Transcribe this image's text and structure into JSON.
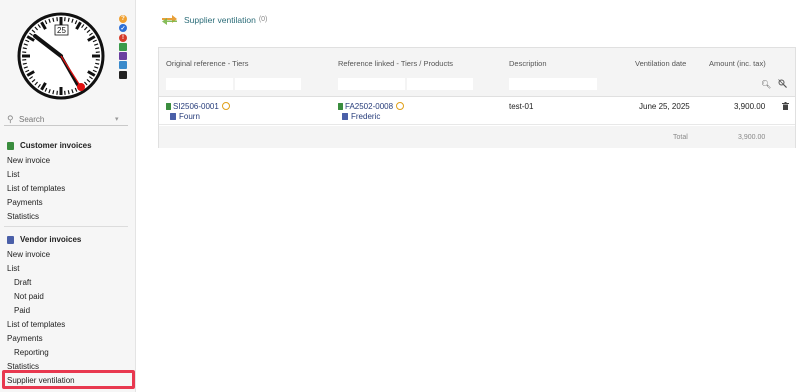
{
  "clock": {
    "digit": "25"
  },
  "search": {
    "placeholder": "Search"
  },
  "menu": {
    "customer_heading": "Customer invoices",
    "customer_items": [
      "New invoice",
      "List",
      "List of templates",
      "Payments",
      "Statistics"
    ],
    "vendor_heading": "Vendor invoices",
    "vendor_items": {
      "new_invoice": "New invoice",
      "list": "List",
      "draft": "Draft",
      "not_paid": "Not paid",
      "paid": "Paid",
      "list_templates": "List of templates",
      "payments": "Payments",
      "reporting": "Reporting",
      "statistics": "Statistics",
      "supplier_ventilation": "Supplier ventilation"
    }
  },
  "page": {
    "title": "Supplier ventilation",
    "count": "(0)"
  },
  "table": {
    "headers": {
      "original_ref": "Original reference - Tiers",
      "reference_linked": "Reference linked - Tiers / Products",
      "description": "Description",
      "ventilation_date": "Ventilation date",
      "amount": "Amount (inc. tax)"
    },
    "rows": [
      {
        "orig_ref": "SI2506-0001",
        "orig_tier": "Fourn",
        "linked_ref": "FA2502-0008",
        "linked_tier": "Frederic",
        "description": "test-01",
        "date": "June 25, 2025",
        "amount": "3,900.00"
      }
    ],
    "total_label": "Total",
    "total_value": "3,900.00"
  },
  "colors": {
    "accent": "#2b6c78",
    "link": "#263c7a",
    "highlight": "#e8384f"
  }
}
